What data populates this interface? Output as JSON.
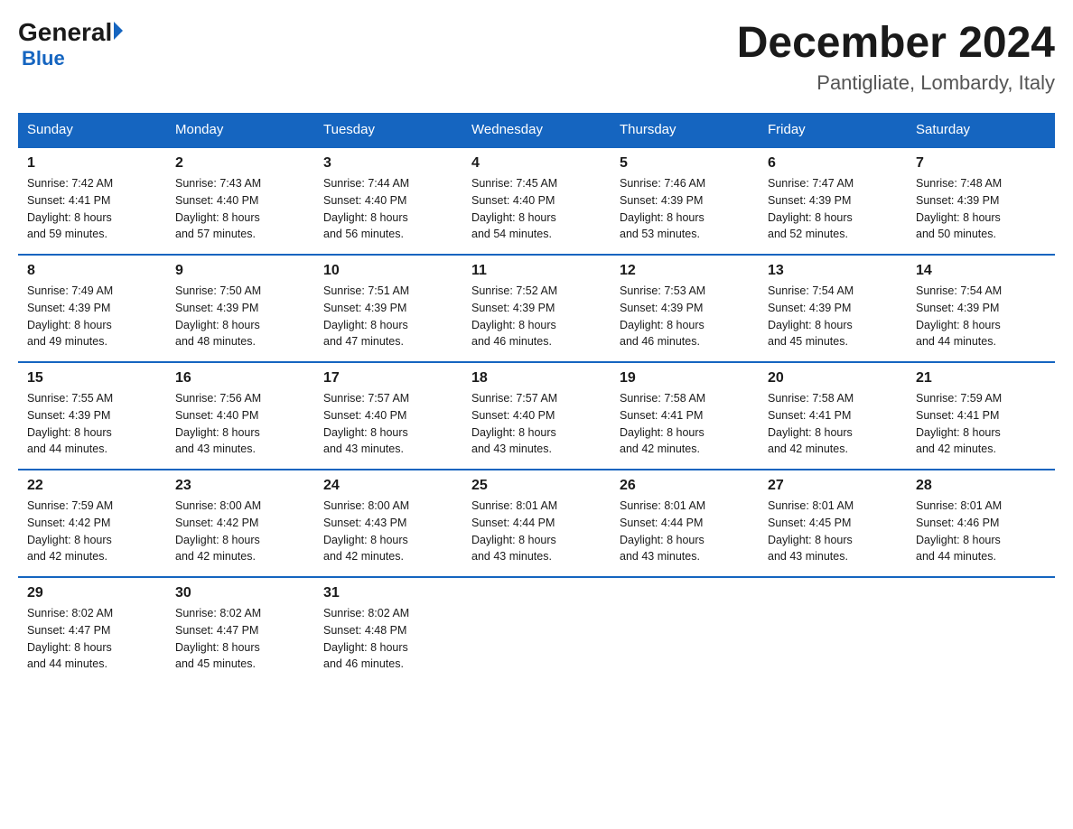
{
  "logo": {
    "general": "General",
    "blue": "Blue",
    "arrow": "▶"
  },
  "title": {
    "month": "December 2024",
    "location": "Pantigliate, Lombardy, Italy"
  },
  "days_of_week": [
    "Sunday",
    "Monday",
    "Tuesday",
    "Wednesday",
    "Thursday",
    "Friday",
    "Saturday"
  ],
  "weeks": [
    [
      {
        "num": "1",
        "info": "Sunrise: 7:42 AM\nSunset: 4:41 PM\nDaylight: 8 hours\nand 59 minutes."
      },
      {
        "num": "2",
        "info": "Sunrise: 7:43 AM\nSunset: 4:40 PM\nDaylight: 8 hours\nand 57 minutes."
      },
      {
        "num": "3",
        "info": "Sunrise: 7:44 AM\nSunset: 4:40 PM\nDaylight: 8 hours\nand 56 minutes."
      },
      {
        "num": "4",
        "info": "Sunrise: 7:45 AM\nSunset: 4:40 PM\nDaylight: 8 hours\nand 54 minutes."
      },
      {
        "num": "5",
        "info": "Sunrise: 7:46 AM\nSunset: 4:39 PM\nDaylight: 8 hours\nand 53 minutes."
      },
      {
        "num": "6",
        "info": "Sunrise: 7:47 AM\nSunset: 4:39 PM\nDaylight: 8 hours\nand 52 minutes."
      },
      {
        "num": "7",
        "info": "Sunrise: 7:48 AM\nSunset: 4:39 PM\nDaylight: 8 hours\nand 50 minutes."
      }
    ],
    [
      {
        "num": "8",
        "info": "Sunrise: 7:49 AM\nSunset: 4:39 PM\nDaylight: 8 hours\nand 49 minutes."
      },
      {
        "num": "9",
        "info": "Sunrise: 7:50 AM\nSunset: 4:39 PM\nDaylight: 8 hours\nand 48 minutes."
      },
      {
        "num": "10",
        "info": "Sunrise: 7:51 AM\nSunset: 4:39 PM\nDaylight: 8 hours\nand 47 minutes."
      },
      {
        "num": "11",
        "info": "Sunrise: 7:52 AM\nSunset: 4:39 PM\nDaylight: 8 hours\nand 46 minutes."
      },
      {
        "num": "12",
        "info": "Sunrise: 7:53 AM\nSunset: 4:39 PM\nDaylight: 8 hours\nand 46 minutes."
      },
      {
        "num": "13",
        "info": "Sunrise: 7:54 AM\nSunset: 4:39 PM\nDaylight: 8 hours\nand 45 minutes."
      },
      {
        "num": "14",
        "info": "Sunrise: 7:54 AM\nSunset: 4:39 PM\nDaylight: 8 hours\nand 44 minutes."
      }
    ],
    [
      {
        "num": "15",
        "info": "Sunrise: 7:55 AM\nSunset: 4:39 PM\nDaylight: 8 hours\nand 44 minutes."
      },
      {
        "num": "16",
        "info": "Sunrise: 7:56 AM\nSunset: 4:40 PM\nDaylight: 8 hours\nand 43 minutes."
      },
      {
        "num": "17",
        "info": "Sunrise: 7:57 AM\nSunset: 4:40 PM\nDaylight: 8 hours\nand 43 minutes."
      },
      {
        "num": "18",
        "info": "Sunrise: 7:57 AM\nSunset: 4:40 PM\nDaylight: 8 hours\nand 43 minutes."
      },
      {
        "num": "19",
        "info": "Sunrise: 7:58 AM\nSunset: 4:41 PM\nDaylight: 8 hours\nand 42 minutes."
      },
      {
        "num": "20",
        "info": "Sunrise: 7:58 AM\nSunset: 4:41 PM\nDaylight: 8 hours\nand 42 minutes."
      },
      {
        "num": "21",
        "info": "Sunrise: 7:59 AM\nSunset: 4:41 PM\nDaylight: 8 hours\nand 42 minutes."
      }
    ],
    [
      {
        "num": "22",
        "info": "Sunrise: 7:59 AM\nSunset: 4:42 PM\nDaylight: 8 hours\nand 42 minutes."
      },
      {
        "num": "23",
        "info": "Sunrise: 8:00 AM\nSunset: 4:42 PM\nDaylight: 8 hours\nand 42 minutes."
      },
      {
        "num": "24",
        "info": "Sunrise: 8:00 AM\nSunset: 4:43 PM\nDaylight: 8 hours\nand 42 minutes."
      },
      {
        "num": "25",
        "info": "Sunrise: 8:01 AM\nSunset: 4:44 PM\nDaylight: 8 hours\nand 43 minutes."
      },
      {
        "num": "26",
        "info": "Sunrise: 8:01 AM\nSunset: 4:44 PM\nDaylight: 8 hours\nand 43 minutes."
      },
      {
        "num": "27",
        "info": "Sunrise: 8:01 AM\nSunset: 4:45 PM\nDaylight: 8 hours\nand 43 minutes."
      },
      {
        "num": "28",
        "info": "Sunrise: 8:01 AM\nSunset: 4:46 PM\nDaylight: 8 hours\nand 44 minutes."
      }
    ],
    [
      {
        "num": "29",
        "info": "Sunrise: 8:02 AM\nSunset: 4:47 PM\nDaylight: 8 hours\nand 44 minutes."
      },
      {
        "num": "30",
        "info": "Sunrise: 8:02 AM\nSunset: 4:47 PM\nDaylight: 8 hours\nand 45 minutes."
      },
      {
        "num": "31",
        "info": "Sunrise: 8:02 AM\nSunset: 4:48 PM\nDaylight: 8 hours\nand 46 minutes."
      },
      null,
      null,
      null,
      null
    ]
  ]
}
